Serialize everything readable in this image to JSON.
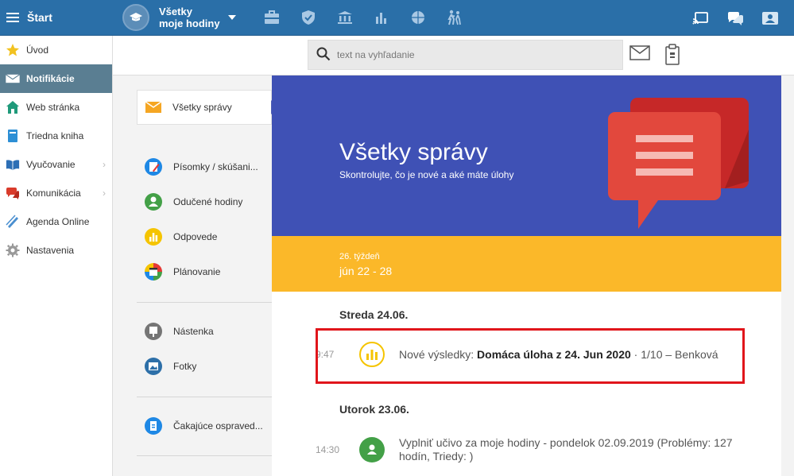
{
  "topbar": {
    "start_label": "Štart",
    "school_name_line1": "Všetky",
    "school_name_line2": "moje hodiny"
  },
  "sidebar": {
    "items": [
      {
        "label": "Úvod",
        "icon": "star-icon"
      },
      {
        "label": "Notifikácie",
        "icon": "envelope-icon",
        "active": true
      },
      {
        "label": "Web stránka",
        "icon": "home-icon"
      },
      {
        "label": "Triedna kniha",
        "icon": "book-icon"
      },
      {
        "label": "Vyučovanie",
        "icon": "open-book-icon"
      },
      {
        "label": "Komunikácia",
        "icon": "chat-icon"
      },
      {
        "label": "Agenda Online",
        "icon": "pen-icon"
      },
      {
        "label": "Nastavenia",
        "icon": "gear-icon"
      }
    ]
  },
  "search": {
    "placeholder": "text na vyhľadanie"
  },
  "midcol": {
    "items": [
      {
        "label": "Všetky správy"
      },
      {
        "label": "Písomky / skúšani..."
      },
      {
        "label": "Odučené hodiny"
      },
      {
        "label": "Odpovede"
      },
      {
        "label": "Plánovanie"
      },
      {
        "label": "Nástenka"
      },
      {
        "label": "Fotky"
      },
      {
        "label": "Čakajúce ospraved..."
      }
    ]
  },
  "hero": {
    "title": "Všetky správy",
    "subtitle": "Skontrolujte, čo je nové a aké máte úlohy"
  },
  "week": {
    "number": "26. týždeň",
    "range": "jún 22 - 28"
  },
  "days": [
    {
      "label": "Streda 24.06.",
      "notifications": [
        {
          "time": "9:47",
          "prefix": "Nové výsledky: ",
          "bold": "Domáca úloha z 24. Jun 2020",
          "suffix": " · 1/10 – Benková"
        }
      ]
    },
    {
      "label": "Utorok 23.06.",
      "notifications": [
        {
          "time": "14:30",
          "text": "Vyplniť učivo za moje hodiny - pondelok 02.09.2019 (Problémy: 127 hodín, Triedy: )"
        }
      ]
    }
  ],
  "colors": {
    "topbar": "#2a6fa8",
    "hero": "#3f51b5",
    "week": "#fbb829",
    "highlight": "#e0151b"
  }
}
